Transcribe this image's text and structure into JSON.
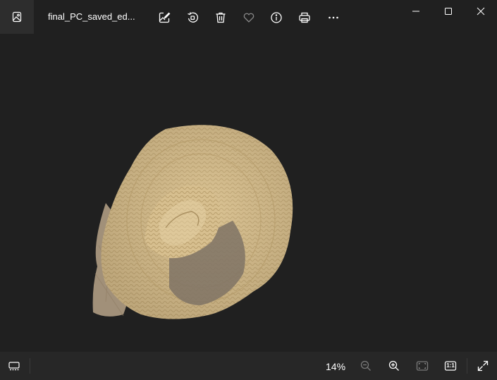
{
  "titlebar": {
    "file_name": "final_PC_saved_ed...",
    "icons": {
      "app": "photos-app-icon",
      "edit": "edit-image-icon",
      "rotate": "rotate-icon",
      "delete": "trash-icon",
      "favorite": "heart-icon",
      "info": "info-icon",
      "print": "print-icon",
      "more": "more-icon"
    },
    "window_controls": [
      "minimize-icon",
      "maximize-icon",
      "close-icon"
    ]
  },
  "image": {
    "subject": "straw-hat",
    "colors": {
      "straw": "#d8c090",
      "straw_dark": "#a08860",
      "shadow": "#7a6e62"
    }
  },
  "bottombar": {
    "zoom_level": "14%",
    "icons": {
      "filmstrip": "filmstrip-icon",
      "zoom_out": "zoom-out-icon",
      "zoom_in": "zoom-in-icon",
      "fit": "fit-to-window-icon",
      "actual_size": "actual-size-icon",
      "actual_size_text": "1:1",
      "fullscreen": "fullscreen-icon"
    }
  },
  "colors": {
    "background": "#202020",
    "bottombar": "#272727",
    "icon": "#ffffff",
    "icon_disabled": "#7a7a7a"
  }
}
